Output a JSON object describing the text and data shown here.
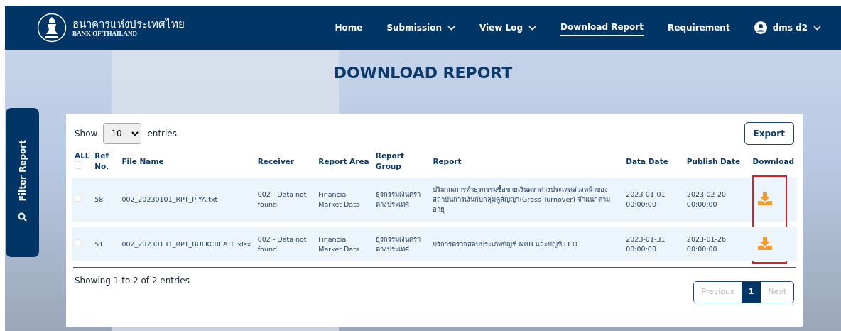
{
  "brand": {
    "name_th": "ธนาคารแห่งประเทศไทย",
    "name_en": "BANK OF THAILAND"
  },
  "nav": [
    {
      "label": "Home",
      "dropdown": false,
      "selected": false
    },
    {
      "label": "Submission",
      "dropdown": true,
      "selected": false
    },
    {
      "label": "View Log",
      "dropdown": true,
      "selected": false
    },
    {
      "label": "Download Report",
      "dropdown": false,
      "selected": true
    },
    {
      "label": "Requirement",
      "dropdown": false,
      "selected": false
    }
  ],
  "user": {
    "name": "dms d2"
  },
  "filter_tab": {
    "label": "Filter Report"
  },
  "page_title": "DOWNLOAD REPORT",
  "length": {
    "show": "Show",
    "value": "10",
    "entries": "entries"
  },
  "export_button": "Export",
  "table": {
    "select_all_label": "ALL",
    "select_all_checked": false,
    "download_highlighted": true,
    "columns": [
      "Ref No.",
      "File Name",
      "Receiver",
      "Report Area",
      "Report Group",
      "Report",
      "Data Date",
      "Publish Date",
      "Download"
    ],
    "rows": [
      {
        "checked": false,
        "ref": "58",
        "file_name": "002_20230101_RPT_PIYA.txt",
        "receiver": "002 - Data not found.",
        "report_area": "Financial Market Data",
        "report_group": "ธุรกรรมเงินตราต่างประเทศ",
        "report": "ปริมาณการทำธุรกรรมซื้อขายเงินตราต่างประเทศล่วงหน้าของสถาบันการเงินกับกลุ่มคู่สัญญา(Gross Turnover) จำแนกตามอายุ",
        "data_date": "2023-01-01 00:00:00",
        "publish_date": "2023-02-20 00:00:00"
      },
      {
        "checked": false,
        "ref": "51",
        "file_name": "002_20230131_RPT_BULKCREATE.xlsx",
        "receiver": "002 - Data not found.",
        "report_area": "Financial Market Data",
        "report_group": "ธุรกรรมเงินตราต่างประเทศ",
        "report": "บริการตรวจสอบประเภทบัญชี NRB และบัญชี FCD",
        "data_date": "2023-01-31 00:00:00",
        "publish_date": "2023-01-26 00:00:00"
      }
    ]
  },
  "info": "Showing 1 to 2 of 2 entries",
  "pagination": [
    {
      "label": "Previous",
      "disabled": true,
      "selected": false
    },
    {
      "label": "1",
      "disabled": false,
      "selected": true
    },
    {
      "label": "Next",
      "disabled": true,
      "selected": false
    }
  ]
}
